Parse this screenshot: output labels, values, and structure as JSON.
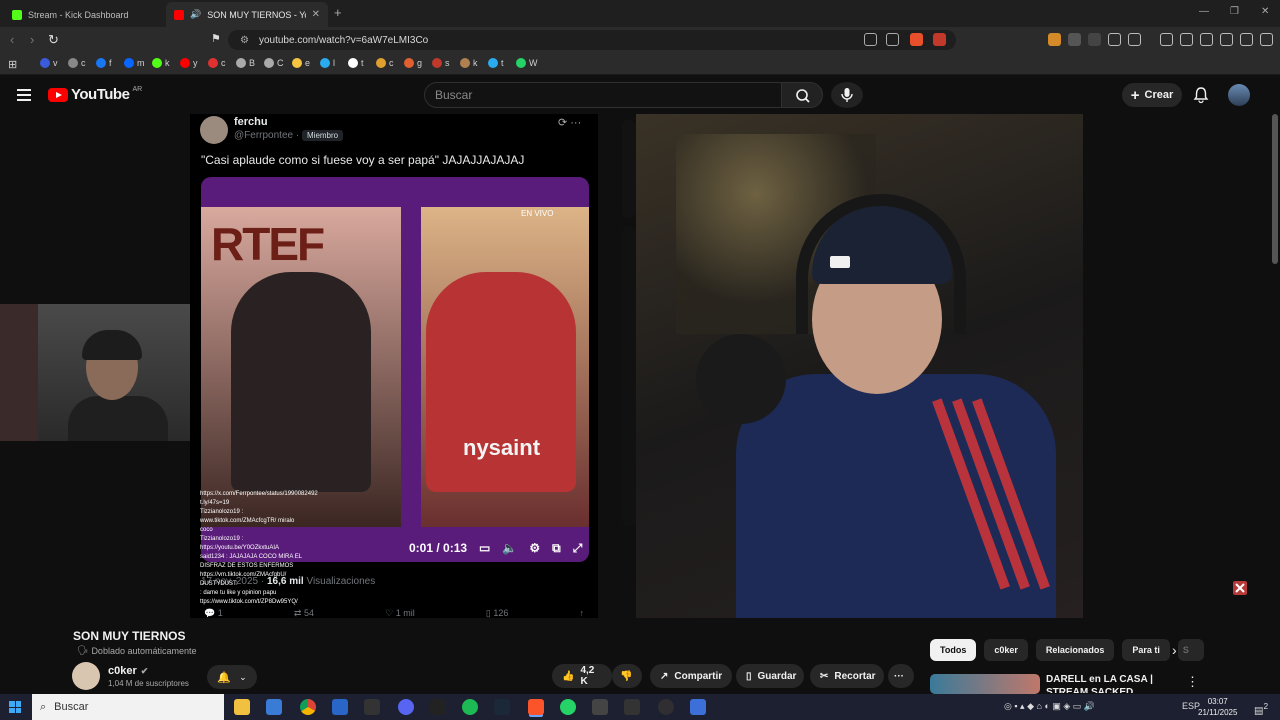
{
  "browser": {
    "tabs": [
      {
        "title": "Stream - Kick Dashboard",
        "favicon_color": "#53fc18"
      },
      {
        "title": "SON MUY TIERNOS - YouTu",
        "favicon_color": "#ff0000"
      }
    ],
    "new_tab": "+",
    "address": "youtube.com/watch?v=6aW7eLMI3Co",
    "bookmarks": [
      {
        "label": "v",
        "color": "#3b5bdb"
      },
      {
        "label": "c",
        "color": "#888"
      },
      {
        "label": "f",
        "color": "#1877f2"
      },
      {
        "label": "m",
        "color": "#0866ff"
      },
      {
        "label": "k",
        "color": "#53fc18"
      },
      {
        "label": "y",
        "color": "#ff0000"
      },
      {
        "label": "c",
        "color": "#e03131"
      },
      {
        "label": "B",
        "color": "#aaa"
      },
      {
        "label": "C",
        "color": "#aaa"
      },
      {
        "label": "e",
        "color": "#f5c542"
      },
      {
        "label": "l",
        "color": "#2aabee"
      },
      {
        "label": "t",
        "color": "#ffffff"
      },
      {
        "label": "c",
        "color": "#e0a030"
      },
      {
        "label": "g",
        "color": "#e06030"
      },
      {
        "label": "s",
        "color": "#c0392b"
      },
      {
        "label": "k",
        "color": "#b08050"
      },
      {
        "label": "t",
        "color": "#2aabee"
      },
      {
        "label": "W",
        "color": "#25d366"
      }
    ]
  },
  "youtube": {
    "logo_text": "YouTube",
    "country": "AR",
    "search_placeholder": "Buscar",
    "create_label": "Crear"
  },
  "tweet": {
    "name": "ferchu",
    "handle": "@Ferrpontee",
    "dot": "·",
    "badge": "Miembro",
    "text": "\"Casi aplaude como si fuese voy a ser papá\" JAJAJJAJAJAJ",
    "media_big_text": "RTEF",
    "live_label": "EN VIVO",
    "overlay_text": "nysaint",
    "video_time": "0:01 / 0:13",
    "date": "17 nov. 2025",
    "views_count": "16,6 mil",
    "views_label": "Visualizaciones",
    "replies": "1",
    "retweets": "54",
    "likes": "1 mil",
    "bookmarks": "126"
  },
  "chat_lines": [
    "https://x.com/Ferrpontee/status/1990082492",
    "t.ly/47s=19",
    "Tizzianolozo19 :",
    "www.tiktok.com/ZMAcfcgTR/ miralo",
    "coco",
    "Tizzianolozo19 :",
    "https://youtu.be/Y0OZkxtuAIA",
    "said1234 : JAJAJAJA COCO MIRA EL",
    "DISFRAZ DE ESTOS ENFERMOS",
    "https://vm.tiktok.com/ZMAcfgbU/",
    "DUSTYDUST:",
    ": dame tu like y opinion papu",
    "ttps://www.tiktok.com/t/ZP8Dw95YQ/"
  ],
  "video_info": {
    "title": "SON MUY TIERNOS",
    "dubbed": "Doblado automáticamente",
    "channel": "c0ker",
    "subscribers": "1,04 M de suscriptores"
  },
  "actions": {
    "likes": "4,2 K",
    "share": "Compartir",
    "save": "Guardar",
    "clip": "Recortar",
    "more": "···"
  },
  "chips": [
    "Todos",
    "c0ker",
    "Relacionados",
    "Para ti",
    "S"
  ],
  "recommendation": {
    "title": "DARELL en LA CASA | STREAM SACKED"
  },
  "taskbar": {
    "search_placeholder": "Buscar",
    "language": "ESP",
    "time": "03:07",
    "date": "21/11/2025",
    "notifications": "2"
  }
}
